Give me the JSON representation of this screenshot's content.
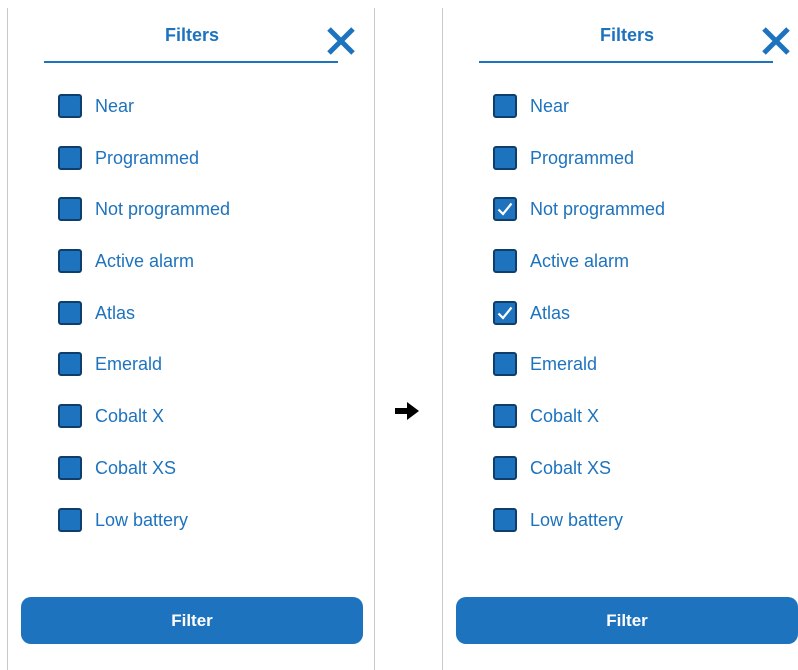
{
  "panels": [
    {
      "title": "Filters",
      "filter_button": "Filter",
      "items": [
        {
          "label": "Near",
          "checked": false
        },
        {
          "label": "Programmed",
          "checked": false
        },
        {
          "label": "Not programmed",
          "checked": false
        },
        {
          "label": "Active alarm",
          "checked": false
        },
        {
          "label": "Atlas",
          "checked": false
        },
        {
          "label": "Emerald",
          "checked": false
        },
        {
          "label": "Cobalt X",
          "checked": false
        },
        {
          "label": "Cobalt XS",
          "checked": false
        },
        {
          "label": "Low battery",
          "checked": false
        }
      ]
    },
    {
      "title": "Filters",
      "filter_button": "Filter",
      "items": [
        {
          "label": "Near",
          "checked": false
        },
        {
          "label": "Programmed",
          "checked": false
        },
        {
          "label": "Not programmed",
          "checked": true
        },
        {
          "label": "Active alarm",
          "checked": false
        },
        {
          "label": "Atlas",
          "checked": true
        },
        {
          "label": "Emerald",
          "checked": false
        },
        {
          "label": "Cobalt X",
          "checked": false
        },
        {
          "label": "Cobalt XS",
          "checked": false
        },
        {
          "label": "Low battery",
          "checked": false
        }
      ]
    }
  ],
  "icons": {
    "close": "close-icon",
    "check": "checkmark-icon",
    "transition": "arrow-right-icon"
  },
  "colors": {
    "accent": "#1e73be",
    "checkbox_border": "#0e3f6c",
    "button_text": "#ffffff"
  }
}
